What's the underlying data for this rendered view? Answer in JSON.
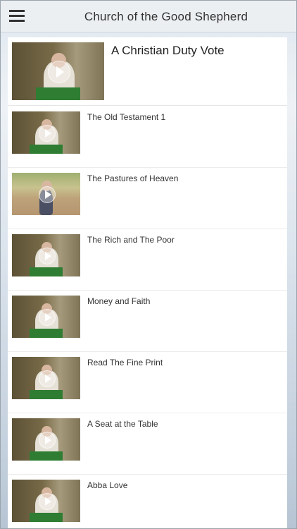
{
  "header": {
    "title": "Church of the Good Shepherd",
    "menu_icon": "hamburger-menu-icon"
  },
  "featured": {
    "title": "A Christian Duty Vote",
    "icon": "play-icon"
  },
  "videos": [
    {
      "title": "The Old Testament 1"
    },
    {
      "title": "The Pastures of Heaven"
    },
    {
      "title": "The Rich and The Poor"
    },
    {
      "title": "Money and Faith"
    },
    {
      "title": "Read The Fine Print"
    },
    {
      "title": "A Seat at the Table"
    },
    {
      "title": "Abba Love"
    }
  ],
  "colors": {
    "header_bg": "#eceff2",
    "text": "#333333",
    "lectern_green": "#2e7d32"
  }
}
